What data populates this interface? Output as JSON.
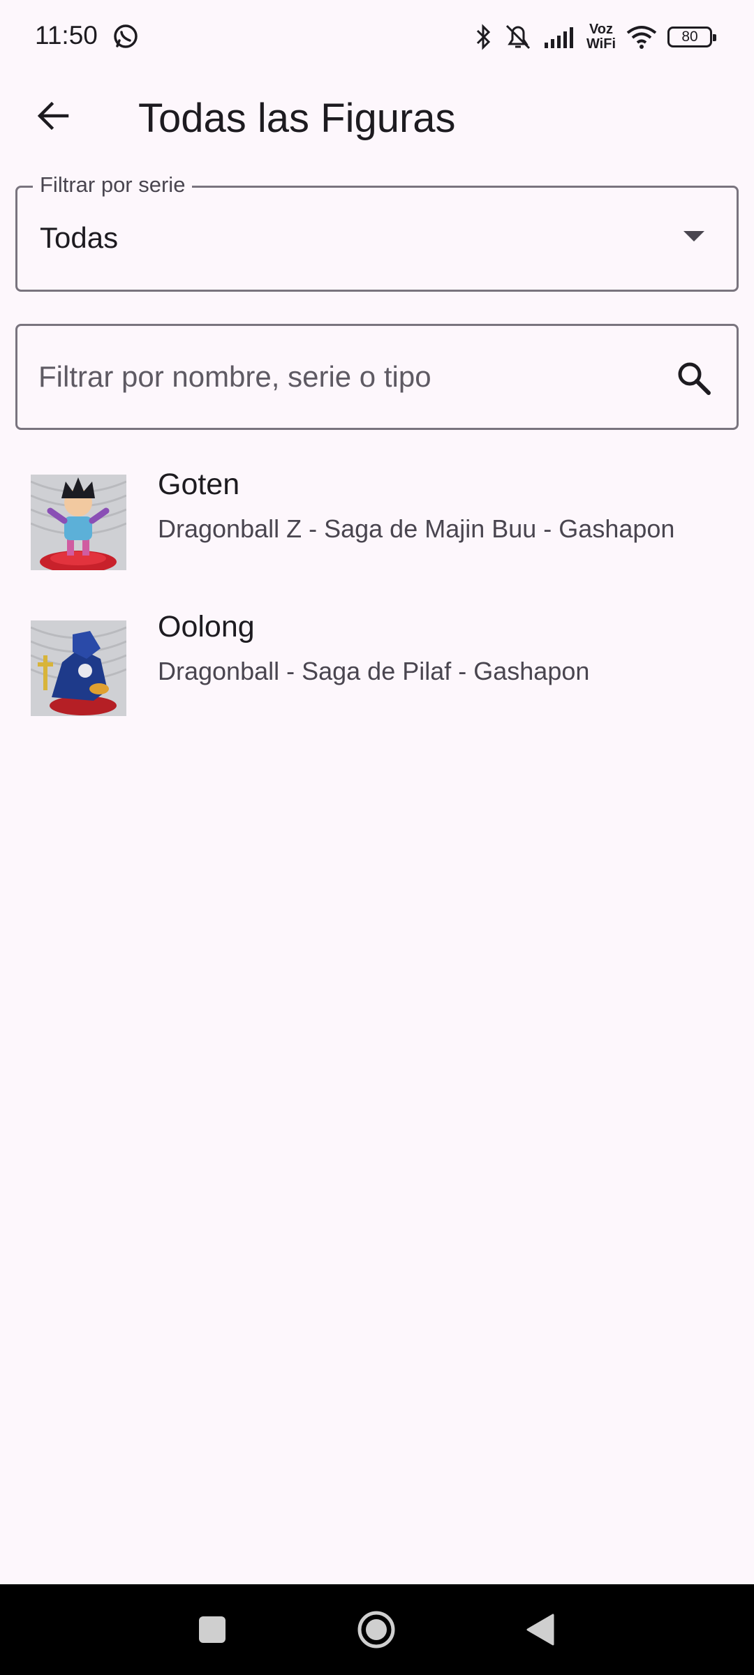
{
  "status_bar": {
    "time": "11:50",
    "voz_line1": "Voz",
    "voz_line2": "WiFi",
    "battery": "80"
  },
  "app_bar": {
    "title": "Todas las Figuras",
    "back_icon": "arrow-back-icon"
  },
  "series_filter": {
    "label": "Filtrar por serie",
    "value": "Todas"
  },
  "search": {
    "placeholder": "Filtrar por nombre, serie o tipo",
    "value": ""
  },
  "figures": [
    {
      "name": "Goten",
      "subtitle": "Dragonball Z - Saga de Majin Buu - Gashapon"
    },
    {
      "name": "Oolong",
      "subtitle": "Dragonball - Saga de Pilaf - Gashapon"
    }
  ],
  "nav": {
    "icons": [
      "recents-icon",
      "home-icon",
      "back-triangle-icon"
    ]
  },
  "colors": {
    "background": "#fdf7fc",
    "outline": "#79747e",
    "text": "#1d1b20",
    "secondary_text": "#49454f"
  }
}
